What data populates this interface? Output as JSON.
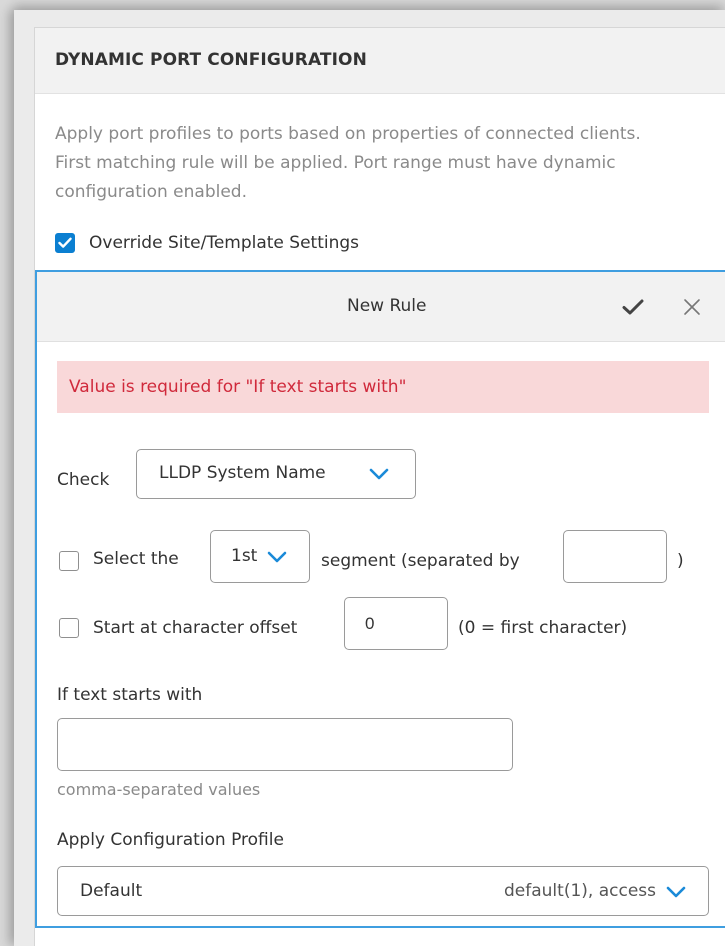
{
  "panel": {
    "title": "DYNAMIC PORT CONFIGURATION",
    "description": "Apply port profiles to ports based on properties of connected clients. First matching rule will be applied. Port range must have dynamic configuration enabled.",
    "override_label": "Override Site/Template Settings",
    "override_checked": true
  },
  "rule": {
    "title": "New Rule",
    "accept_icon": "check-icon",
    "close_icon": "close-icon",
    "error_message": "Value is required for \"If text starts with\"",
    "check_label": "Check",
    "check_value": "LLDP System Name",
    "select_label": "Select the",
    "segment_value": "1st",
    "segment_label": "segment (separated by",
    "separator_value": "",
    "close_paren": ")",
    "select_checked": false,
    "offset_label": "Start at character offset",
    "offset_value": "0",
    "offset_hint": "(0 = first character)",
    "offset_checked": false,
    "starts_with_label": "If text starts with",
    "starts_with_value": "",
    "starts_with_hint": "comma-separated values",
    "profile_label": "Apply Configuration Profile",
    "profile_value": "Default",
    "profile_detail": "default(1), access"
  },
  "colors": {
    "accent": "#0b7fd1",
    "rule_border": "#3f9ee0",
    "error_bg": "#f9d8d9",
    "error_text": "#d0293b"
  }
}
